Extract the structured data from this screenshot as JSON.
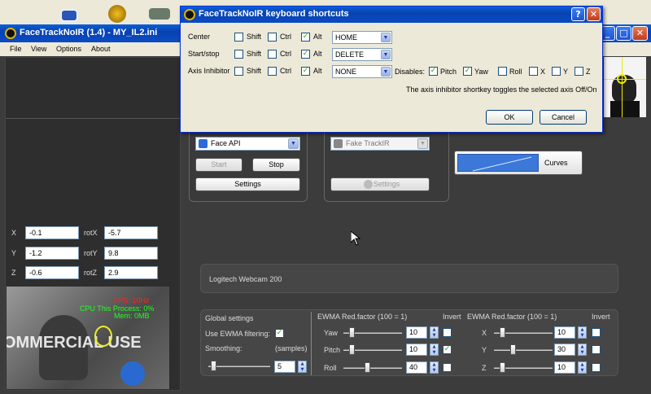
{
  "main_window": {
    "title": "FaceTrackNoIR (1.4) - MY_IL2.ini",
    "menu": [
      "File",
      "View",
      "Options",
      "About"
    ]
  },
  "dialog": {
    "title": "FaceTrackNoIR keyboard shortcuts",
    "modifier_labels": [
      "Shift",
      "Ctrl",
      "Alt"
    ],
    "rows": [
      {
        "label": "Center",
        "shift": false,
        "ctrl": false,
        "alt": true,
        "key": "HOME"
      },
      {
        "label": "Start/stop",
        "shift": false,
        "ctrl": false,
        "alt": true,
        "key": "DELETE"
      },
      {
        "label": "Axis Inhibitor",
        "shift": false,
        "ctrl": false,
        "alt": true,
        "key": "NONE"
      }
    ],
    "disables_label": "Disables:",
    "disables": [
      {
        "label": "Pitch",
        "checked": true
      },
      {
        "label": "Yaw",
        "checked": true
      },
      {
        "label": "Roll",
        "checked": false
      },
      {
        "label": "X",
        "checked": false
      },
      {
        "label": "Y",
        "checked": false
      },
      {
        "label": "Z",
        "checked": false
      }
    ],
    "note": "The axis inhibitor shortkey toggles the selected axis Off/On",
    "ok_label": "OK",
    "cancel_label": "Cancel"
  },
  "tracker": {
    "selected": "Face API",
    "start_label": "Start",
    "stop_label": "Stop",
    "settings_label": "Settings"
  },
  "protocol": {
    "selected": "Fake TrackIR",
    "settings_label": "Settings"
  },
  "curves_label": "Curves",
  "camera_name": "Logitech Webcam 200",
  "pose": {
    "X": "-0.1",
    "Y": "-1.2",
    "Z": "-0.6",
    "rotX": "-5.7",
    "rotY": "9.8",
    "rotZ": "2.9"
  },
  "video_overlay": {
    "fps": "FPS: 10Hz",
    "cpu": "CPU This Process: 0%",
    "mem": "Mem: 0MB",
    "watermark": "OMMERCIAL USE"
  },
  "global_settings": {
    "title": "Global settings",
    "ewma_label": "Use EWMA filtering:",
    "ewma_checked": true,
    "smoothing_label": "Smoothing:",
    "samples_label": "(samples)",
    "smoothing_value": "5",
    "smoothing_fraction": 0.05
  },
  "rotation_filter": {
    "ewma_label": "EWMA",
    "redfactor_label": "Red.factor (100 = 1)",
    "invert_label": "Invert",
    "rows": [
      {
        "label": "Yaw",
        "value": "10",
        "fraction": 0.1,
        "invert": false
      },
      {
        "label": "Pitch",
        "value": "10",
        "fraction": 0.1,
        "invert": true
      },
      {
        "label": "Roll",
        "value": "40",
        "fraction": 0.4,
        "invert": false
      }
    ]
  },
  "translation_filter": {
    "ewma_label": "EWMA",
    "redfactor_label": "Red.factor (100 = 1)",
    "invert_label": "Invert",
    "rows": [
      {
        "label": "X",
        "value": "10",
        "fraction": 0.1,
        "invert": false
      },
      {
        "label": "Y",
        "value": "30",
        "fraction": 0.3,
        "invert": false
      },
      {
        "label": "Z",
        "value": "10",
        "fraction": 0.1,
        "invert": false
      }
    ]
  }
}
